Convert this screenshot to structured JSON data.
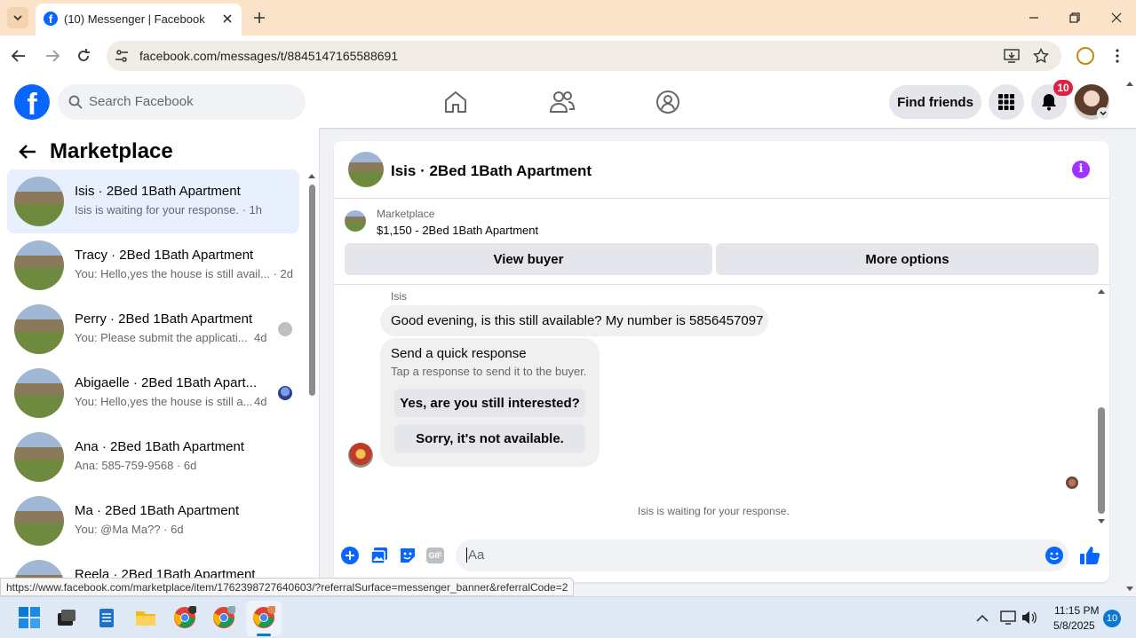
{
  "browser": {
    "tab_title": "(10) Messenger | Facebook",
    "url": "facebook.com/messages/t/8845147165588691",
    "status_url": "https://www.facebook.com/marketplace/item/1762398727640603/?referralSurface=messenger_banner&referralCode=2"
  },
  "header": {
    "search_placeholder": "Search Facebook",
    "find_friends": "Find friends",
    "notifications_count": "10"
  },
  "left_panel": {
    "title": "Marketplace",
    "conversations": [
      {
        "title": "Isis · 2Bed 1Bath Apartment",
        "preview": "Isis is waiting for your response. · 1h"
      },
      {
        "title": "Tracy · 2Bed 1Bath Apartment",
        "preview": "You: Hello,yes the house is still avail... · 2d"
      },
      {
        "title": "Perry · 2Bed 1Bath Apartment",
        "preview": "You: Please submit the applicati...",
        "time": "4d"
      },
      {
        "title": "Abigaelle · 2Bed 1Bath Apart...",
        "preview": "You: Hello,yes the house is still a...",
        "time": "4d"
      },
      {
        "title": "Ana · 2Bed 1Bath Apartment",
        "preview": "Ana: 585-759-9568 · 6d"
      },
      {
        "title": "Ma · 2Bed 1Bath Apartment",
        "preview": "You: @Ma Ma?? · 6d"
      },
      {
        "title": "Reela · 2Bed 1Bath Apartment",
        "preview": ""
      }
    ]
  },
  "chat": {
    "title": "Isis · 2Bed 1Bath Apartment",
    "listing_source": "Marketplace",
    "listing_detail": "$1,150 - 2Bed 1Bath Apartment",
    "view_buyer": "View buyer",
    "more_options": "More options",
    "sender_name": "Isis",
    "message": "Good evening, is this still available? My number is 5856457097",
    "quick_title": "Send a quick response",
    "quick_subtitle": "Tap a response to send it to the buyer.",
    "quick_option_1": "Yes, are you still interested?",
    "quick_option_2": "Sorry, it's not available.",
    "waiting_text": "Isis is waiting for your response.",
    "composer_placeholder": "Aa"
  },
  "taskbar": {
    "time": "11:15 PM",
    "date": "5/8/2025",
    "notification_badge": "10"
  },
  "colors": {
    "fb_blue": "#0866ff",
    "messenger_purple": "#a033ff",
    "tab_bar": "#fbe3c9",
    "notification_red": "#e41e3f"
  }
}
